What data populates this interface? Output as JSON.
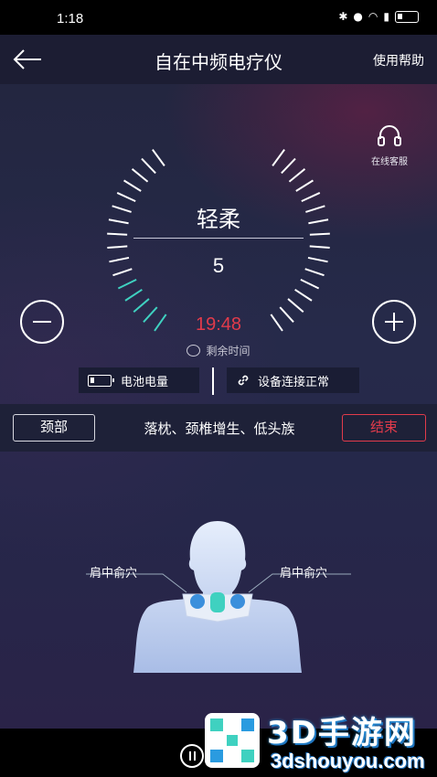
{
  "status_bar": {
    "time": "1:18"
  },
  "app_bar": {
    "title": "自在中频电疗仪",
    "help_label": "使用帮助"
  },
  "service": {
    "label": "在线客服"
  },
  "dial": {
    "mode": "轻柔",
    "intensity": "5",
    "active_color": "#3fd1c0",
    "tick_color": "#ffffff"
  },
  "timer": {
    "value": "19:48",
    "label": "剩余时间",
    "color": "#e23b4b"
  },
  "info": {
    "battery_label": "电池电量",
    "connection_label": "设备连接正常"
  },
  "region": {
    "body_part": "颈部",
    "symptoms": "落枕、颈椎增生、低头族",
    "end_label": "结束"
  },
  "figure": {
    "acupoint_left": "肩中俞穴",
    "acupoint_right": "肩中俞穴"
  },
  "watermark": {
    "title": "3D手游网",
    "url": "3dshouyou.com"
  }
}
